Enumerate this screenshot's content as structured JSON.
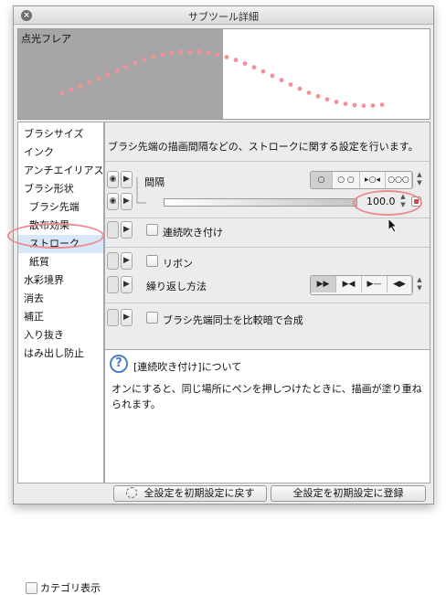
{
  "window": {
    "title": "サブツール詳細"
  },
  "preview": {
    "label": "点光フレア"
  },
  "categories": [
    {
      "label": "ブラシサイズ",
      "selected": false,
      "sub": false
    },
    {
      "label": "インク",
      "selected": false,
      "sub": false
    },
    {
      "label": "アンチエイリアス",
      "selected": false,
      "sub": false
    },
    {
      "label": "ブラシ形状",
      "selected": false,
      "sub": false
    },
    {
      "label": "ブラシ先端",
      "selected": false,
      "sub": true
    },
    {
      "label": "散布効果",
      "selected": false,
      "sub": true
    },
    {
      "label": "ストローク",
      "selected": true,
      "sub": true
    },
    {
      "label": "紙質",
      "selected": false,
      "sub": true
    },
    {
      "label": "水彩境界",
      "selected": false,
      "sub": false
    },
    {
      "label": "消去",
      "selected": false,
      "sub": false
    },
    {
      "label": "補正",
      "selected": false,
      "sub": false
    },
    {
      "label": "入り抜き",
      "selected": false,
      "sub": false
    },
    {
      "label": "はみ出し防止",
      "selected": false,
      "sub": false
    }
  ],
  "category_toggle": {
    "label": "カテゴリ表示",
    "checked": false
  },
  "description": "ブラシ先端の描画間隔などの、ストロークに関する設定を行います。",
  "settings": {
    "interval": {
      "label": "間隔",
      "options": [
        "○",
        "○ ○",
        "▸○◂",
        "○○○"
      ],
      "selected_index": 0,
      "value": "100.0"
    },
    "continuous_spray": {
      "label": "連続吹き付け",
      "checked": false
    },
    "ribbon": {
      "label": "リボン",
      "checked": false
    },
    "repeat_method": {
      "label": "繰り返し方法",
      "options": [
        "▶▶",
        "▶◀",
        "▶—",
        "◀▶"
      ],
      "selected_index": 0
    },
    "compare_brightness": {
      "label": "ブラシ先端同士を比較暗で合成",
      "checked": false
    }
  },
  "info": {
    "heading": "[連続吹き付け]について",
    "body": "オンにすると、同じ場所にペンを押しつけたときに、描画が塗り重ねられます。"
  },
  "footer": {
    "reset_label": "全設定を初期設定に戻す",
    "register_label": "全設定を初期設定に登録"
  },
  "colors": {
    "highlight_ring": "#ec8a8e",
    "selection": "#d7e7f8",
    "stroke_dots": "#f4909a"
  }
}
